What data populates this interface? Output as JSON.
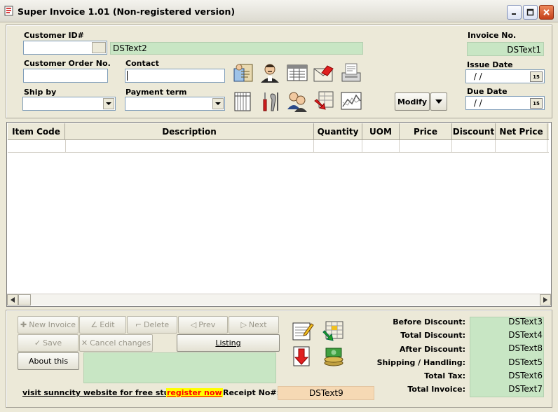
{
  "window": {
    "title": "Super Invoice 1.01 (Non-registered version)"
  },
  "header": {
    "customer_id_label": "Customer ID#",
    "customer_id_value": "",
    "customer_name_display": "DSText2",
    "customer_order_label": "Customer Order No.",
    "customer_order_value": "",
    "contact_label": "Contact",
    "contact_value": "",
    "ship_by_label": "Ship by",
    "ship_by_value": "",
    "payment_term_label": "Payment term",
    "payment_term_value": "",
    "invoice_no_label": "Invoice No.",
    "invoice_no_value": "DSText1",
    "issue_date_label": "Issue Date",
    "issue_date_value": " / /",
    "due_date_label": "Due Date",
    "due_date_value": " / /",
    "modify_label": "Modify"
  },
  "toolbar_icons": [
    "customers-icon",
    "salesperson-icon",
    "invoice-list-icon",
    "email-icon",
    "fax-icon",
    "ledger-icon",
    "tools-icon",
    "users-icon",
    "import-icon",
    "chart-icon"
  ],
  "grid": {
    "columns": [
      "Item Code",
      "Description",
      "Quantity",
      "UOM",
      "Price",
      "Discount",
      "Net Price"
    ]
  },
  "actions": {
    "new_invoice": "New Invoice",
    "edit": "Edit",
    "delete": "Delete",
    "prev": "Prev",
    "next": "Next",
    "save": "Save",
    "cancel_changes": "Cancel changes",
    "listing": "Listing",
    "about": "About this"
  },
  "footer": {
    "website_link": "visit sunncity website for free stuff",
    "register_link": "register now",
    "receipt_label": "Receipt No#:",
    "receipt_value": "DSText9"
  },
  "totals": [
    {
      "label": "Before Discount:",
      "value": "DSText3"
    },
    {
      "label": "Total Discount:",
      "value": "DSText4"
    },
    {
      "label": "After Discount:",
      "value": "DSText8"
    },
    {
      "label": "Shipping / Handling:",
      "value": "DSText5"
    },
    {
      "label": "Total Tax:",
      "value": "DSText6"
    },
    {
      "label": "Total Invoice:",
      "value": "DSText7"
    }
  ],
  "colors": {
    "green_field": "#c8e6c4",
    "receipt_field": "#f6d9b4",
    "register": "#ff0000",
    "register_bg": "#ffff00"
  }
}
